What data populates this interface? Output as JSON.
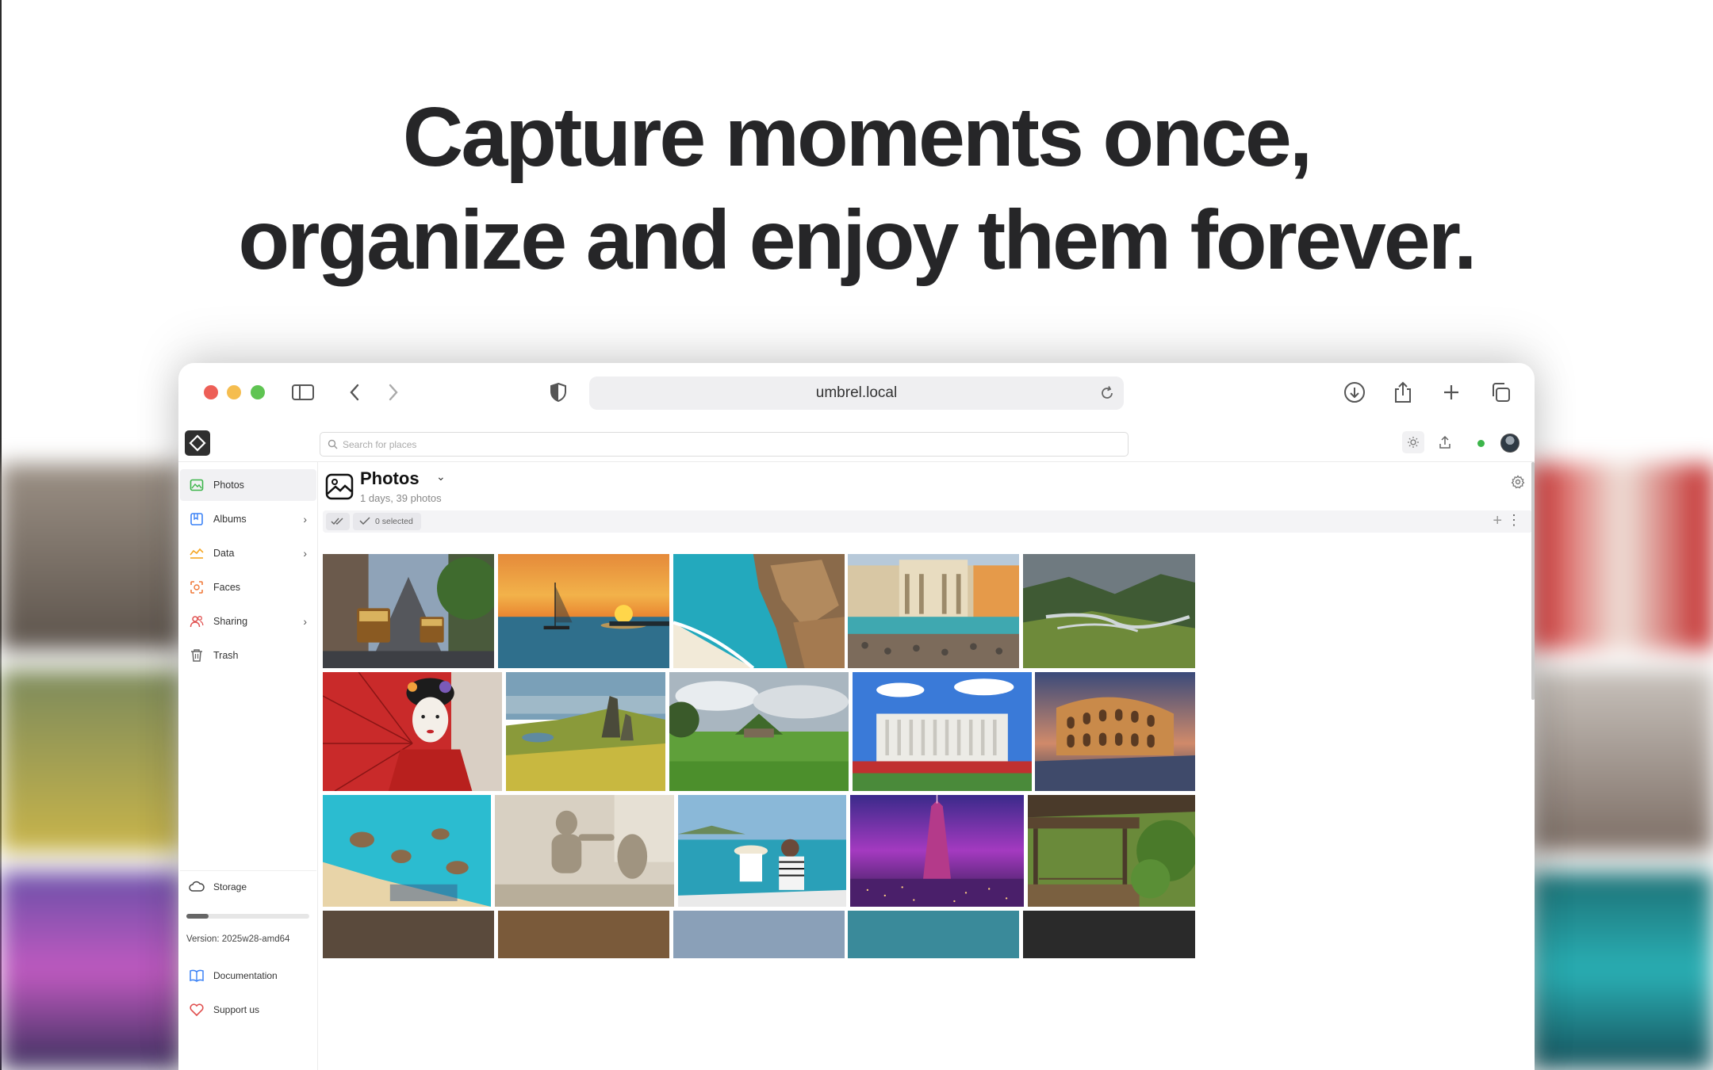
{
  "headline": {
    "line1": "Capture moments once,",
    "line2": "organize and enjoy them forever."
  },
  "browser": {
    "url": "umbrel.local"
  },
  "app": {
    "search_placeholder": "Search for places",
    "sidebar": {
      "items": [
        {
          "label": "Photos",
          "icon": "photos-icon",
          "color": "#3cb54a",
          "active": true,
          "chevron": false
        },
        {
          "label": "Albums",
          "icon": "albums-icon",
          "color": "#3b82f6",
          "active": false,
          "chevron": true
        },
        {
          "label": "Data",
          "icon": "data-icon",
          "color": "#f5a623",
          "active": false,
          "chevron": true
        },
        {
          "label": "Faces",
          "icon": "faces-icon",
          "color": "#f07a3a",
          "active": false,
          "chevron": false
        },
        {
          "label": "Sharing",
          "icon": "sharing-icon",
          "color": "#e0504f",
          "active": false,
          "chevron": true
        },
        {
          "label": "Trash",
          "icon": "trash-icon",
          "color": "#666666",
          "active": false,
          "chevron": false
        }
      ],
      "storage_label": "Storage",
      "storage_used_fraction": 0.18,
      "version": "Version: 2025w28-amd64",
      "documentation_label": "Documentation",
      "support_label": "Support us"
    },
    "page": {
      "title": "Photos",
      "subtitle": "1 days, 39 photos",
      "selected_label": "0 selected"
    },
    "photos": [
      {
        "name": "San Francisco cable cars",
        "scene": "city"
      },
      {
        "name": "Sunset sailboat",
        "scene": "sunset"
      },
      {
        "name": "Aerial beach rocks",
        "scene": "beach"
      },
      {
        "name": "Trevi Fountain",
        "scene": "fountain"
      },
      {
        "name": "Highland river valley",
        "scene": "valley"
      },
      {
        "name": "Geisha with red umbrella",
        "scene": "geisha"
      },
      {
        "name": "Old Man of Storr",
        "scene": "storr"
      },
      {
        "name": "Turf house meadow",
        "scene": "meadow"
      },
      {
        "name": "Altare della Patria",
        "scene": "monument"
      },
      {
        "name": "Colosseum dusk",
        "scene": "colosseum"
      },
      {
        "name": "Aerial turquoise coast",
        "scene": "coast"
      },
      {
        "name": "Fountain sculpture",
        "scene": "statue"
      },
      {
        "name": "Couple on boat",
        "scene": "boat"
      },
      {
        "name": "Transamerica pyramid night",
        "scene": "skyline"
      },
      {
        "name": "Japanese pavilion",
        "scene": "pavilion"
      }
    ]
  }
}
